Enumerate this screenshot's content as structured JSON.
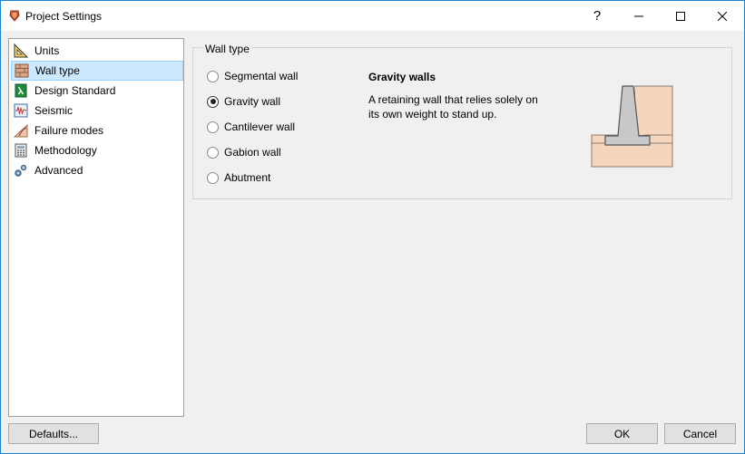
{
  "window": {
    "title": "Project Settings"
  },
  "titlebar_buttons": {
    "help": "?"
  },
  "sidebar": {
    "items": [
      {
        "label": "Units",
        "icon": "triangle-ruler-icon"
      },
      {
        "label": "Wall type",
        "icon": "brick-wall-icon",
        "selected": true
      },
      {
        "label": "Design Standard",
        "icon": "lambda-book-icon"
      },
      {
        "label": "Seismic",
        "icon": "seismograph-icon"
      },
      {
        "label": "Failure modes",
        "icon": "slope-failure-icon"
      },
      {
        "label": "Methodology",
        "icon": "calculator-icon"
      },
      {
        "label": "Advanced",
        "icon": "gears-icon"
      }
    ]
  },
  "wall_type": {
    "group_label": "Wall type",
    "options": [
      {
        "label": "Segmental wall",
        "checked": false
      },
      {
        "label": "Gravity wall",
        "checked": true
      },
      {
        "label": "Cantilever wall",
        "checked": false
      },
      {
        "label": "Gabion wall",
        "checked": false
      },
      {
        "label": "Abutment",
        "checked": false
      }
    ],
    "description_title": "Gravity walls",
    "description_text": "A retaining wall that relies solely on its own weight to stand up."
  },
  "footer": {
    "defaults_label": "Defaults...",
    "ok_label": "OK",
    "cancel_label": "Cancel"
  },
  "colors": {
    "selection_bg": "#cce8ff",
    "soil": "#f5d6bd",
    "wall": "#c8c8c8",
    "window_border": "#1883d7"
  }
}
